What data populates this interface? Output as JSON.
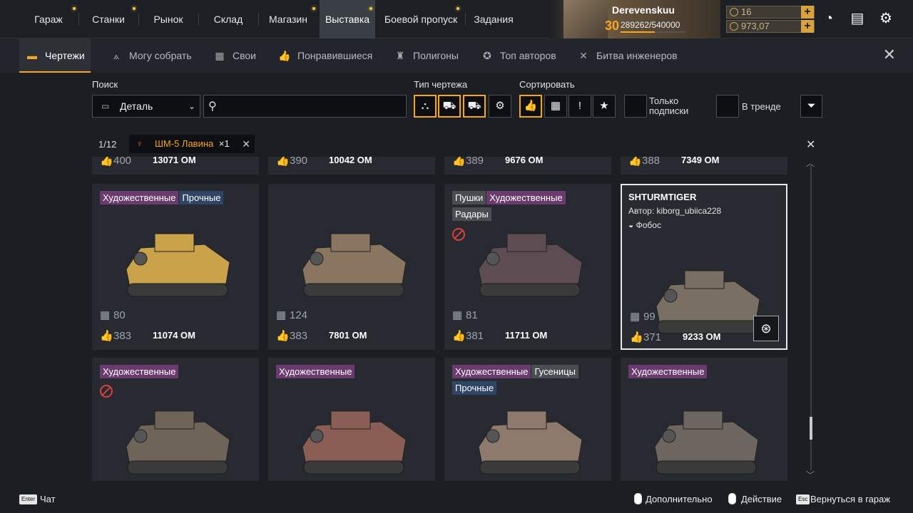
{
  "topnav": {
    "tabs": [
      "Гараж",
      "Станки",
      "Рынок",
      "Склад",
      "Магазин",
      "Выставка",
      "Боевой пропуск",
      "Задания"
    ],
    "active": "Выставка"
  },
  "player": {
    "name": "Derevenskuu",
    "level": "30",
    "xp": "289262/540000",
    "xp_fraction": 0.535
  },
  "currency": {
    "coins": "16",
    "gold": "973,07"
  },
  "subtabs": [
    {
      "label": "Чертежи",
      "icon": "car-icon"
    },
    {
      "label": "Могу собрать",
      "icon": "compass-icon"
    },
    {
      "label": "Свои",
      "icon": "blueprint-icon"
    },
    {
      "label": "Понравившиеся",
      "icon": "thumbs-up-icon"
    },
    {
      "label": "Полигоны",
      "icon": "dummy-icon"
    },
    {
      "label": "Топ авторов",
      "icon": "laurel-icon"
    },
    {
      "label": "Битва инженеров",
      "icon": "tools-icon"
    }
  ],
  "filters": {
    "search_label": "Поиск",
    "part_value": "Деталь",
    "search_placeholder": "",
    "type_label": "Тип чертежа",
    "sort_label": "Сортировать",
    "subs_label_1": "Только",
    "subs_label_2": "подписки",
    "trend_label": "В тренде"
  },
  "selection": {
    "page": "1/12",
    "name": "ШМ-5 Лавина",
    "count": "×1"
  },
  "top_row": [
    {
      "likes": "400",
      "om": "13071 ОМ"
    },
    {
      "likes": "390",
      "om": "10042 ОМ"
    },
    {
      "likes": "389",
      "om": "9676 ОМ"
    },
    {
      "likes": "388",
      "om": "7349 ОМ"
    }
  ],
  "cards": [
    {
      "tags": [
        {
          "t": "Художественные",
          "k": "art"
        },
        {
          "t": "Прочные",
          "k": "hard"
        }
      ],
      "builds": "80",
      "likes": "383",
      "om": "11074 ОМ",
      "banned": false,
      "color": "#c9a24a"
    },
    {
      "tags": [],
      "builds": "124",
      "likes": "383",
      "om": "7801 ОМ",
      "banned": false,
      "color": "#8a7660"
    },
    {
      "tags": [
        {
          "t": "Пушки",
          "k": "gun"
        },
        {
          "t": "Художественные",
          "k": "art"
        },
        {
          "t": "Радары",
          "k": "gun"
        }
      ],
      "builds": "81",
      "likes": "381",
      "om": "11711 ОМ",
      "banned": true,
      "color": "#5d4d52"
    },
    {
      "tags": [],
      "builds": "99",
      "likes": "371",
      "om": "9233 ОМ",
      "banned": false,
      "color": "#7a6f63",
      "selected": true,
      "name": "SHTURMTIGER",
      "author": "Автор:  kiborg_ubiica228",
      "faction": "Фобос"
    },
    {
      "tags": [
        {
          "t": "Художественные",
          "k": "art"
        }
      ],
      "banned": true,
      "color": "#6f6458"
    },
    {
      "tags": [
        {
          "t": "Художественные",
          "k": "art"
        }
      ],
      "banned": false,
      "color": "#8a5d55"
    },
    {
      "tags": [
        {
          "t": "Художественные",
          "k": "art"
        },
        {
          "t": "Гусеницы",
          "k": "gun"
        },
        {
          "t": "Прочные",
          "k": "hard"
        }
      ],
      "banned": false,
      "color": "#8d7a6c"
    },
    {
      "tags": [
        {
          "t": "Художественные",
          "k": "art"
        }
      ],
      "banned": false,
      "color": "#6d6560"
    }
  ],
  "bottom": {
    "chat_key": "Enter",
    "chat": "Чат",
    "more": "Дополнительно",
    "action": "Действие",
    "esc_key": "Esc",
    "back": "Вернуться в гараж"
  }
}
